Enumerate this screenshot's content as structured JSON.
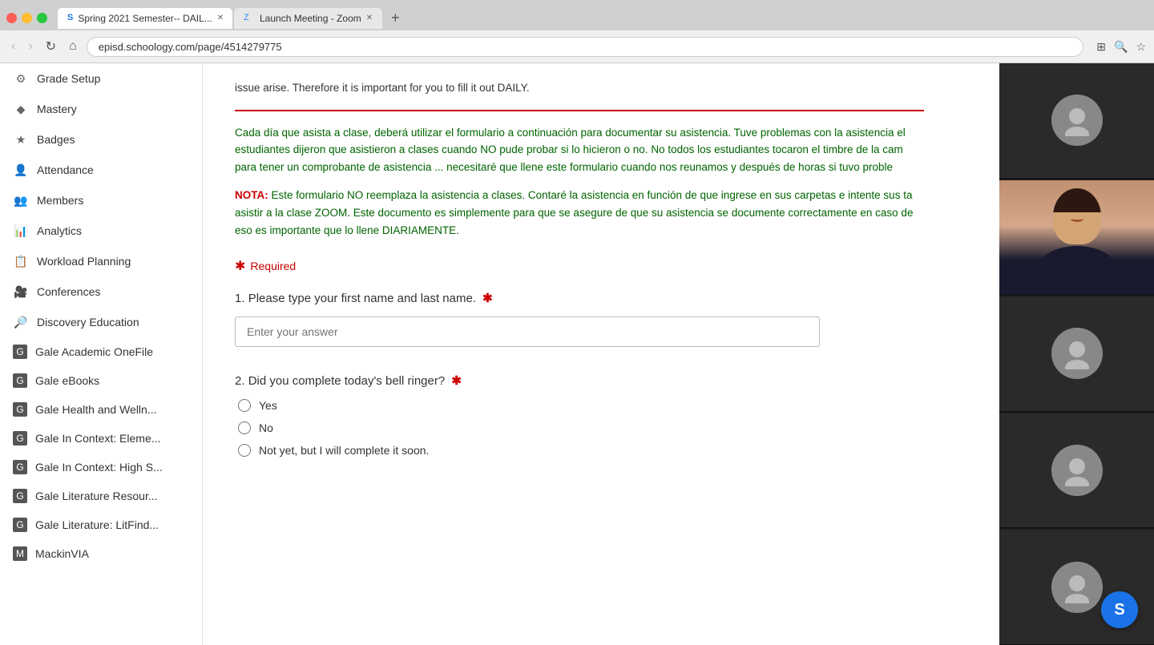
{
  "browser": {
    "tabs": [
      {
        "id": "tab1",
        "favicon": "S",
        "label": "Spring 2021 Semester-- DAIL...",
        "active": true
      },
      {
        "id": "tab2",
        "favicon": "Z",
        "label": "Launch Meeting - Zoom",
        "active": false
      }
    ],
    "address": "episd.schoology.com/page/4514279775",
    "nav": {
      "back": "‹",
      "forward": "›",
      "refresh": "↺",
      "home": "⌂"
    }
  },
  "sidebar": {
    "items": [
      {
        "id": "grade-setup",
        "icon": "⚙",
        "label": "Grade Setup"
      },
      {
        "id": "mastery",
        "icon": "◆",
        "label": "Mastery"
      },
      {
        "id": "badges",
        "icon": "★",
        "label": "Badges"
      },
      {
        "id": "attendance",
        "icon": "👤",
        "label": "Attendance"
      },
      {
        "id": "members",
        "icon": "👥",
        "label": "Members"
      },
      {
        "id": "analytics",
        "icon": "📊",
        "label": "Analytics"
      },
      {
        "id": "workload-planning",
        "icon": "📋",
        "label": "Workload Planning"
      },
      {
        "id": "conferences",
        "icon": "🎥",
        "label": "Conferences"
      },
      {
        "id": "discovery-education",
        "icon": "🔎",
        "label": "Discovery Education"
      },
      {
        "id": "gale-academic",
        "icon": "📁",
        "label": "Gale Academic OneFile"
      },
      {
        "id": "gale-ebooks",
        "icon": "📁",
        "label": "Gale eBooks"
      },
      {
        "id": "gale-health",
        "icon": "📁",
        "label": "Gale Health and Welln..."
      },
      {
        "id": "gale-context-elem",
        "icon": "📁",
        "label": "Gale In Context: Eleme..."
      },
      {
        "id": "gale-context-high",
        "icon": "📁",
        "label": "Gale In Context: High S..."
      },
      {
        "id": "gale-literature-resour",
        "icon": "📁",
        "label": "Gale Literature Resour..."
      },
      {
        "id": "gale-literature-litfind",
        "icon": "📁",
        "label": "Gale Literature: LitFind..."
      },
      {
        "id": "mackinvia",
        "icon": "📁",
        "label": "MackinVIA"
      }
    ]
  },
  "content": {
    "intro_text": "issue arise. Therefore it is important for you to fill it out DAILY.",
    "divider": true,
    "paragraph1": "Cada día que asista a clase, deberá utilizar el formulario a continuación para documentar su asistencia. Tuve problemas con la asistencia el estudiantes dijeron que asistieron a clases cuando NO pude probar si lo hicieron o no. No todos los estudiantes tocaron el timbre de la cam para tener un comprobante de asistencia ... necesitaré que llene este formulario cuando nos reunamos y después de horas si tuvo proble",
    "nota_label": "NOTA:",
    "nota_text": " Este formulario NO reemplaza la asistencia a clases. Contaré la asistencia en función de que ingrese en sus carpetas e intente sus ta asistir a la clase ZOOM. Este documento es simplemente para que se asegure de que su asistencia se documente correctamente en caso de eso es importante que lo llene DIARIAMENTE.",
    "required_label": "Required",
    "question1": {
      "number": "1.",
      "text": "Please type your first name and last name.",
      "required": true,
      "placeholder": "Enter your answer"
    },
    "question2": {
      "number": "2.",
      "text": "Did you complete today's bell ringer?",
      "required": true,
      "options": [
        {
          "id": "yes",
          "label": "Yes"
        },
        {
          "id": "no",
          "label": "No"
        },
        {
          "id": "not-yet",
          "label": "Not yet, but I will complete it soon."
        }
      ]
    }
  },
  "zoom": {
    "slots": [
      {
        "type": "avatar"
      },
      {
        "type": "person-with-photo"
      },
      {
        "type": "avatar"
      },
      {
        "type": "avatar"
      },
      {
        "type": "avatar"
      }
    ]
  },
  "user_badge": {
    "initial": "S",
    "color": "#1a73e8"
  }
}
